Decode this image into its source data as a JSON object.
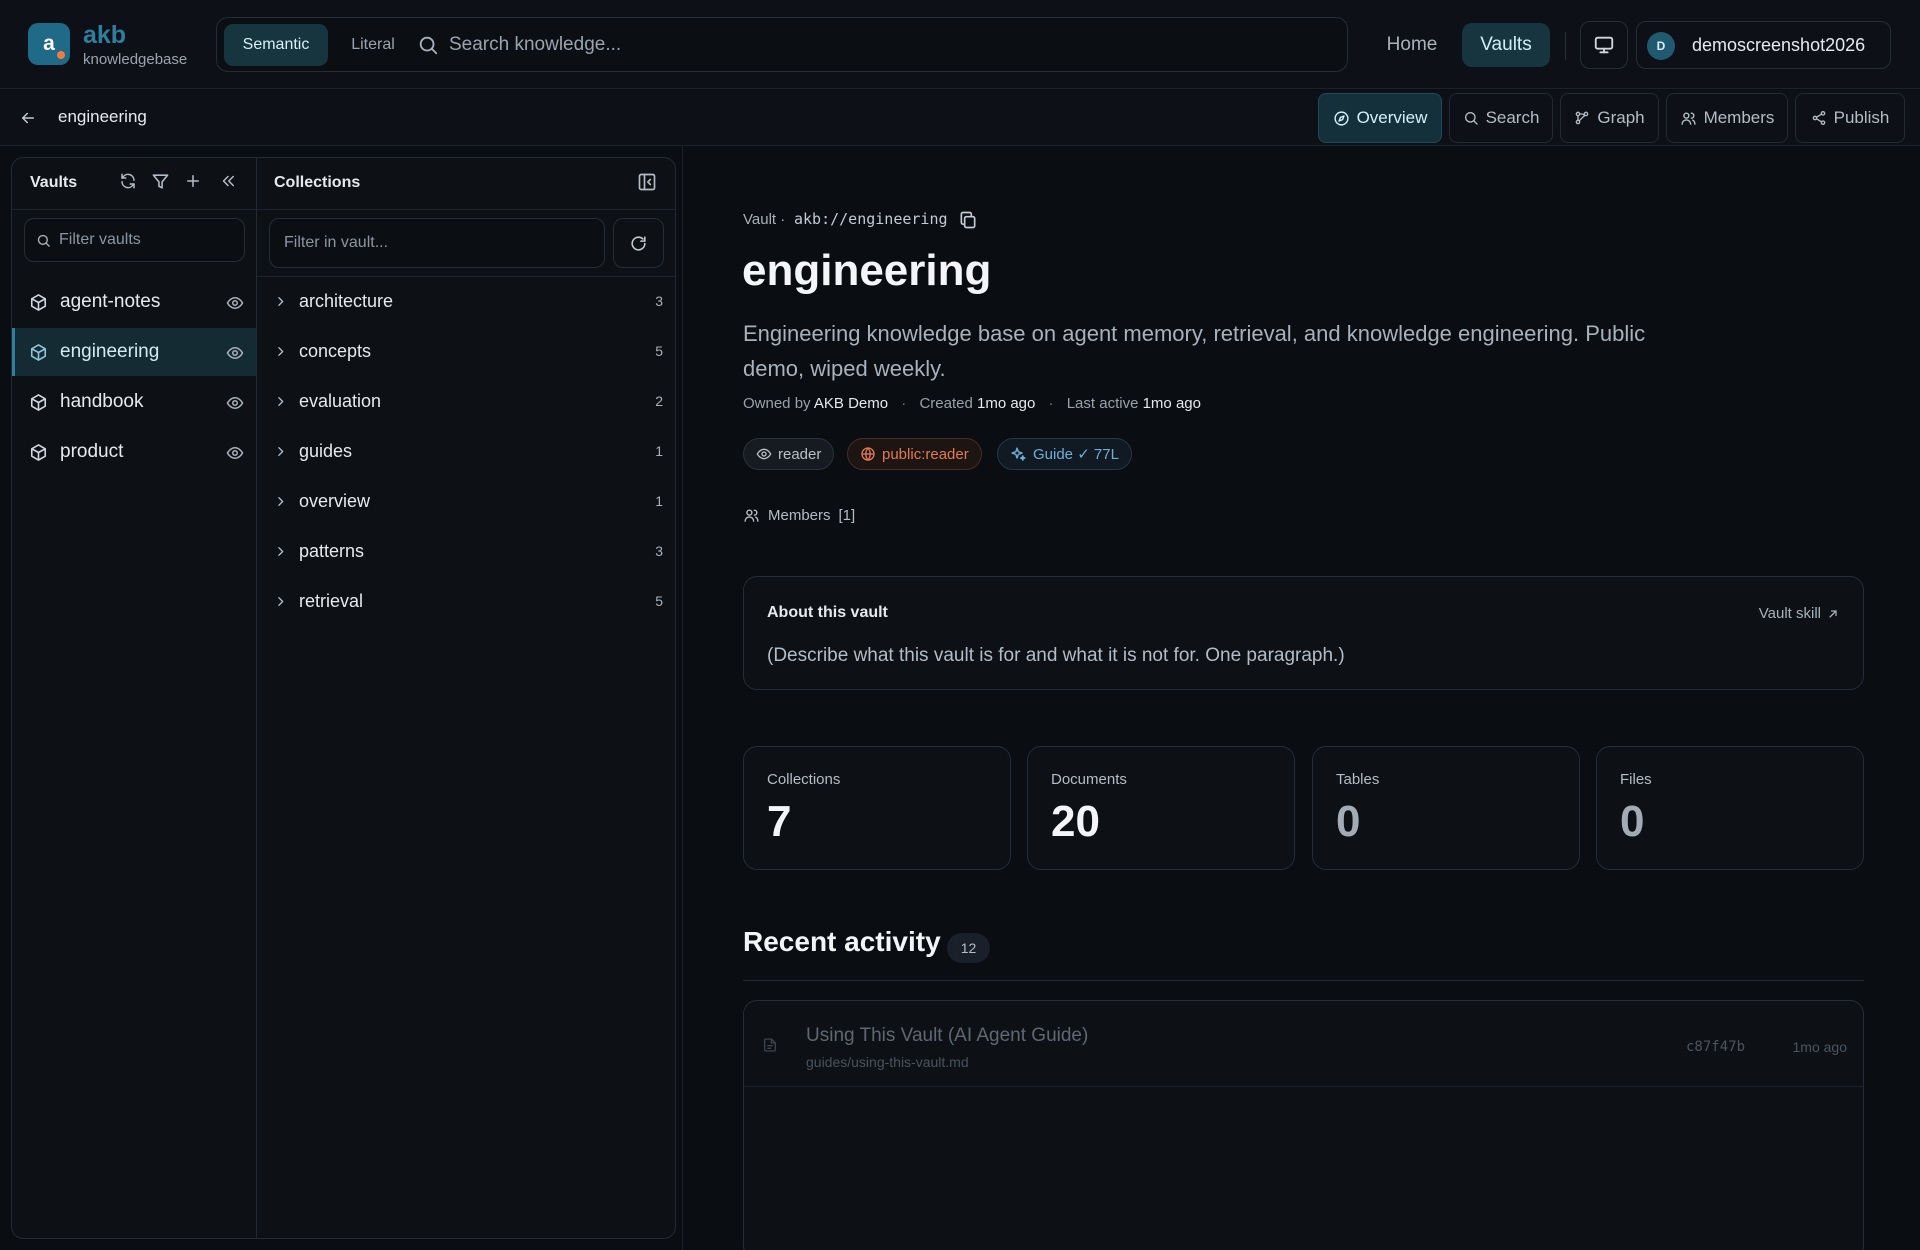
{
  "header": {
    "brand": {
      "logo_letter": "a",
      "name": "akb",
      "subtitle": "knowledgebase",
      "logo_color": "#1f6b87",
      "logo_dot_color": "#f07a45"
    },
    "search": {
      "modes": [
        "Semantic",
        "Literal"
      ],
      "active_mode": "Semantic",
      "placeholder": "Search knowledge..."
    },
    "nav": {
      "home": "Home",
      "vaults": "Vaults",
      "active": "Vaults"
    },
    "icons": {
      "display": "monitor-icon"
    },
    "user": {
      "initial": "D",
      "name": "demoscreenshot2026"
    }
  },
  "subheader": {
    "breadcrumb": "engineering",
    "tabs": [
      {
        "label": "Overview",
        "icon": "compass-icon",
        "active": true
      },
      {
        "label": "Search",
        "icon": "search-icon",
        "active": false
      },
      {
        "label": "Graph",
        "icon": "graph-icon",
        "active": false
      },
      {
        "label": "Members",
        "icon": "users-icon",
        "active": false
      },
      {
        "label": "Publish",
        "icon": "share-icon",
        "active": false
      }
    ]
  },
  "vaults_panel": {
    "title": "Vaults",
    "filter_placeholder": "Filter vaults",
    "items": [
      {
        "label": "agent-notes",
        "active": false
      },
      {
        "label": "engineering",
        "active": true
      },
      {
        "label": "handbook",
        "active": false
      },
      {
        "label": "product",
        "active": false
      }
    ]
  },
  "collections_panel": {
    "title": "Collections",
    "filter_placeholder": "Filter in vault...",
    "items": [
      {
        "label": "architecture",
        "count": "3"
      },
      {
        "label": "concepts",
        "count": "5"
      },
      {
        "label": "evaluation",
        "count": "2"
      },
      {
        "label": "guides",
        "count": "1"
      },
      {
        "label": "overview",
        "count": "1"
      },
      {
        "label": "patterns",
        "count": "3"
      },
      {
        "label": "retrieval",
        "count": "5"
      }
    ]
  },
  "main": {
    "vault_label": "Vault ·",
    "uri": "akb://engineering",
    "title": "engineering",
    "description": "Engineering knowledge base on agent memory, retrieval, and knowledge engineering. Public demo, wiped weekly.",
    "meta": {
      "owned_prefix": "Owned by",
      "owner": "AKB Demo",
      "created_prefix": "Created",
      "created": "1mo ago",
      "active_prefix": "Last active",
      "last_active": "1mo ago"
    },
    "badges": {
      "reader": "reader",
      "public": "public:reader",
      "guide": "Guide ✓ 77L"
    },
    "members": {
      "label": "Members",
      "count": "[1]"
    },
    "about": {
      "title": "About this vault",
      "skill_link": "Vault skill",
      "text": "(Describe what this vault is for and what it is not for. One paragraph.)"
    },
    "stats": [
      {
        "label": "Collections",
        "value": "7"
      },
      {
        "label": "Documents",
        "value": "20"
      },
      {
        "label": "Tables",
        "value": "0"
      },
      {
        "label": "Files",
        "value": "0"
      }
    ],
    "recent": {
      "title": "Recent activity",
      "count": "12",
      "items": [
        {
          "title": "Using This Vault (AI Agent Guide)",
          "path": "guides/using-this-vault.md",
          "hash": "c87f47b",
          "time": "1mo ago"
        }
      ]
    }
  }
}
